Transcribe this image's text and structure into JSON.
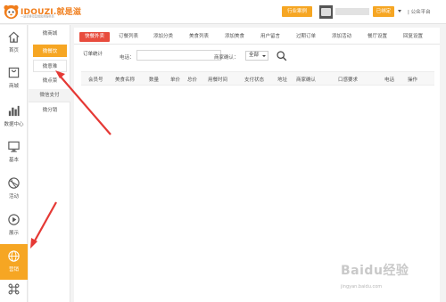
{
  "header": {
    "logo_title": "IDOUZI.就是滋",
    "logo_subtitle": "一站式移动营销应用服务商",
    "industry_button": "行业案例",
    "bound_button": "已绑定",
    "platform_link": "| 公众平台"
  },
  "sidebar": {
    "items": [
      {
        "label": "首页",
        "icon": "home-icon"
      },
      {
        "label": "商城",
        "icon": "store-icon"
      },
      {
        "label": "数据中心",
        "icon": "bar-chart-icon"
      },
      {
        "label": "基本",
        "icon": "monitor-icon"
      },
      {
        "label": "活动",
        "icon": "basketball-icon"
      },
      {
        "label": "展示",
        "icon": "play-circle-icon"
      },
      {
        "label": "营销",
        "icon": "globe-icon",
        "active": true
      },
      {
        "label": "",
        "icon": "command-icon"
      }
    ],
    "accent_color": "#f6a623"
  },
  "subnav": {
    "items": [
      {
        "label": "微商城"
      },
      {
        "label": "微餐饮",
        "active": true
      },
      {
        "label": "微意难"
      },
      {
        "label": "微点菜"
      }
    ],
    "group_label": "微信支付",
    "group_items": [
      {
        "label": "微分销"
      }
    ]
  },
  "tabs": [
    {
      "label": "快餐外卖",
      "active": true
    },
    {
      "label": "订餐列表"
    },
    {
      "label": "添加分类"
    },
    {
      "label": "美食列表"
    },
    {
      "label": "添加美食"
    },
    {
      "label": "用户留言"
    },
    {
      "label": "过期订单"
    },
    {
      "label": "添加活动"
    },
    {
      "label": "餐厅设置"
    },
    {
      "label": "回复设置"
    }
  ],
  "filters": {
    "section_title": "订单统计",
    "phone_label": "电话：",
    "phone_value": "",
    "status_label": "商家确认：",
    "status_value": "全部"
  },
  "table": {
    "columns": [
      "会员号",
      "美食名称",
      "数量",
      "单价",
      "总价",
      "用餐时间",
      "支付状态",
      "地址",
      "商家确认",
      "口感要求",
      "电话",
      "操作"
    ]
  },
  "watermark": {
    "text": "Baidu经验",
    "url": "jingyan.baidu.com"
  },
  "colors": {
    "tab_active": "#e84c3d",
    "accent": "#f6a623",
    "annotation_arrow": "#e53935"
  }
}
